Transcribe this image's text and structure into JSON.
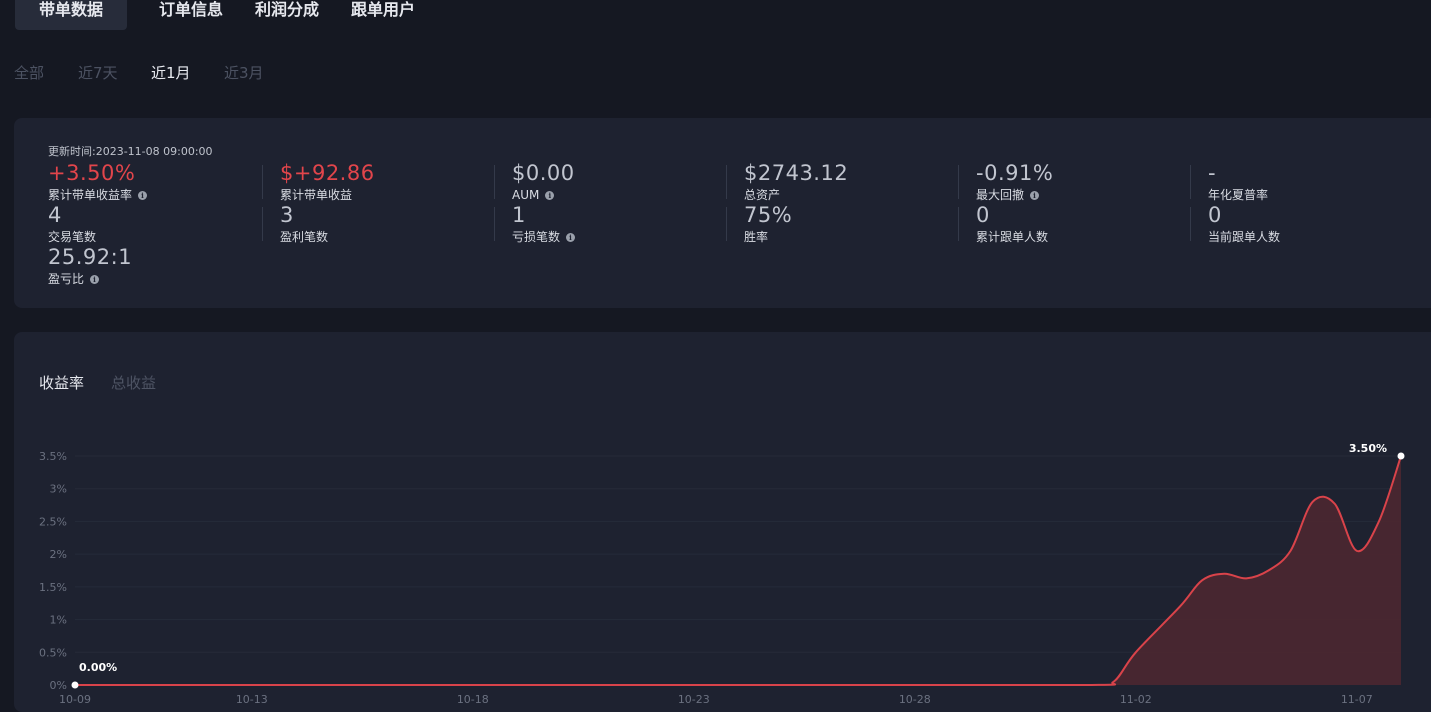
{
  "tabs": [
    {
      "label": "带单数据",
      "active": true
    },
    {
      "label": "订单信息",
      "active": false
    },
    {
      "label": "利润分成",
      "active": false
    },
    {
      "label": "跟单用户",
      "active": false
    }
  ],
  "range": [
    {
      "label": "全部",
      "active": false
    },
    {
      "label": "近7天",
      "active": false
    },
    {
      "label": "近1月",
      "active": true
    },
    {
      "label": "近3月",
      "active": false
    }
  ],
  "stats": {
    "update_time": "更新时间:2023-11-08 09:00:00",
    "cumulative_return_rate": {
      "value": "+3.50%",
      "label": "累计带单收益率"
    },
    "cumulative_profit": {
      "value": "$+92.86",
      "label": "累计带单收益"
    },
    "aum": {
      "value": "$0.00",
      "label": "AUM"
    },
    "total_assets": {
      "value": "$2743.12",
      "label": "总资产"
    },
    "max_drawdown": {
      "value": "-0.91%",
      "label": "最大回撤"
    },
    "sharpe": {
      "value": "-",
      "label": "年化夏普率"
    },
    "trades": {
      "value": "4",
      "label": "交易笔数"
    },
    "win_trades": {
      "value": "3",
      "label": "盈利笔数"
    },
    "loss_trades": {
      "value": "1",
      "label": "亏损笔数"
    },
    "win_rate": {
      "value": "75%",
      "label": "胜率"
    },
    "cum_followers": {
      "value": "0",
      "label": "累计跟单人数"
    },
    "cur_followers": {
      "value": "0",
      "label": "当前跟单人数"
    },
    "pl_ratio": {
      "value": "25.92:1",
      "label": "盈亏比"
    }
  },
  "chart_tabs": [
    {
      "label": "收益率",
      "active": true
    },
    {
      "label": "总收益",
      "active": false
    }
  ],
  "colors": {
    "line": "#d9434a",
    "fill": "#4a2730",
    "positive": "#e2454b"
  },
  "chart_data": {
    "type": "area",
    "ylim": [
      0,
      3.5
    ],
    "yticks": [
      "0%",
      "0.5%",
      "1%",
      "1.5%",
      "2%",
      "2.5%",
      "3%",
      "3.5%"
    ],
    "xticks": [
      "10-09",
      "10-13",
      "10-18",
      "10-23",
      "10-28",
      "11-02",
      "11-07"
    ],
    "x": [
      "10-09",
      "10-27",
      "11-01",
      "11-01",
      "11-02",
      "11-03",
      "11-03",
      "11-04",
      "11-04",
      "11-05",
      "11-05",
      "11-06",
      "11-06",
      "11-07",
      "11-07",
      "11-08"
    ],
    "values": [
      0,
      0,
      0,
      0.05,
      0.5,
      1.2,
      1.6,
      1.7,
      1.63,
      1.75,
      2.05,
      2.8,
      2.77,
      2.05,
      2.5,
      3.5
    ],
    "start_label": "0.00%",
    "end_label": "3.50%",
    "series_name": ""
  }
}
